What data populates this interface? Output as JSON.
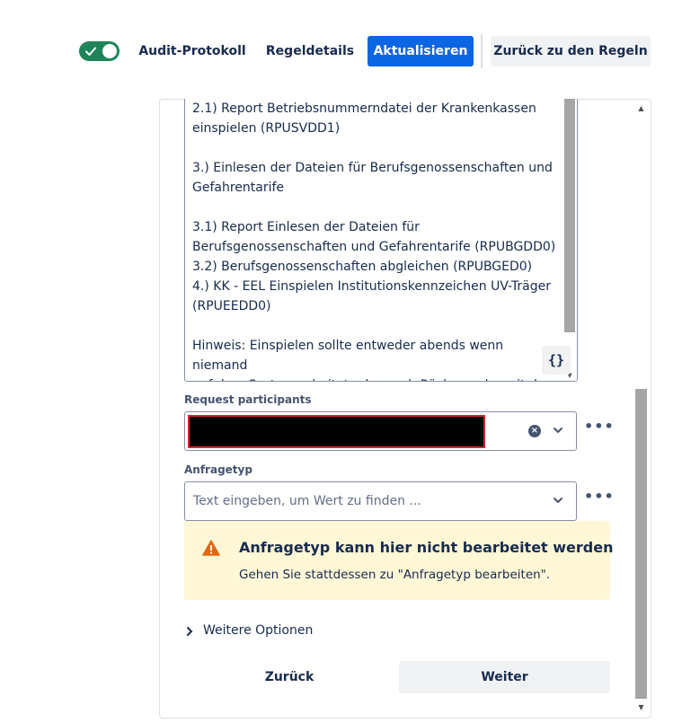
{
  "toolbar": {
    "toggle_state": "on",
    "audit_label": "Audit-Protokoll",
    "details_label": "Regeldetails",
    "update_label": "Aktualisieren",
    "back_rules_label": "Zurück zu den Regeln"
  },
  "description": {
    "lines": [
      "2.1) Report Betriebsnummerndatei der Krankenkassen",
      "einspielen (RPUSVDD1)",
      "",
      "3.) Einlesen der Dateien für Berufsgenossenschaften und",
      "Gefahrentarife",
      "",
      "3.1) Report Einlesen der Dateien für",
      "Berufsgenossenschaften und Gefahrentarife (RPUBGDD0)",
      "3.2) Berufsgenossenschaften abgleichen (RPUBGED0)",
      "4.) KK - EEL Einspielen Institutionskennzeichen UV-Träger",
      "(RPUEEDD0)",
      "",
      "Hinweis: Einspielen sollte entweder abends wenn niemand",
      "auf dem System arbeitet oder nach Rücksprache mit dem"
    ],
    "json_button": "{}"
  },
  "participants": {
    "label": "Request participants"
  },
  "request_type": {
    "label": "Anfragetyp",
    "placeholder": "Text eingeben, um Wert zu finden ..."
  },
  "warning": {
    "title": "Anfragetyp kann hier nicht bearbeitet werden",
    "body": "Gehen Sie stattdessen zu \"Anfragetyp bearbeiten\"."
  },
  "more_options": "Weitere Optionen",
  "footer": {
    "back_label": "Zurück",
    "next_label": "Weiter"
  },
  "colors": {
    "primary": "#0c66e4",
    "toggle": "#1f845a",
    "warning_bg": "#fff7d6",
    "warning_icon": "#e56910"
  }
}
